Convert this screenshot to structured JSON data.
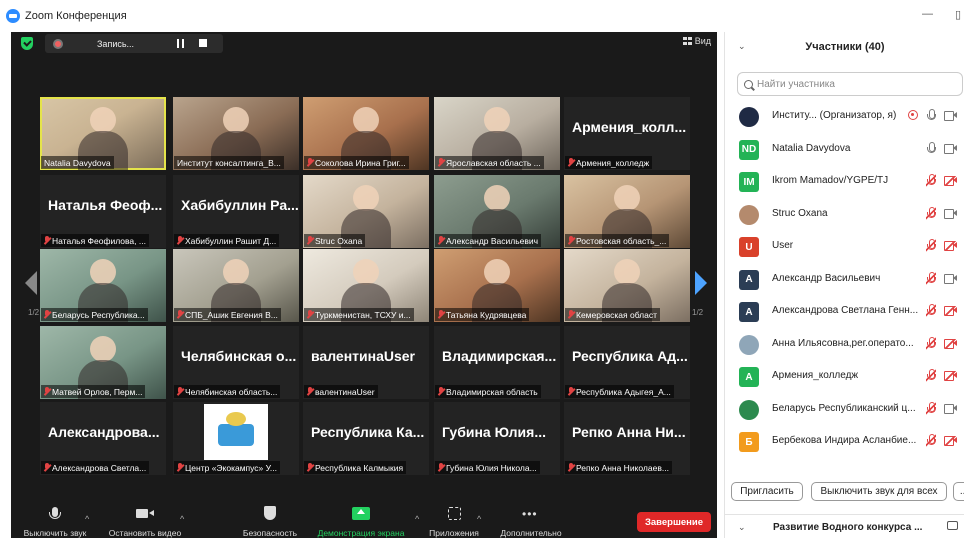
{
  "window": {
    "title": "Zoom Конференция",
    "minimize": "—",
    "maximize": "▯"
  },
  "topbar": {
    "record_label": "Запись...",
    "view_label": "Вид"
  },
  "gallery": {
    "page_left": "1/2",
    "page_right": "1/2",
    "tiles": [
      {
        "caption": "Natalia Davydova",
        "bigname": "",
        "muted": false
      },
      {
        "caption": "Институт консалтинга_В...",
        "bigname": "",
        "muted": false
      },
      {
        "caption": "Соколова Ирина Григ...",
        "bigname": "",
        "muted": true
      },
      {
        "caption": "Ярославская область ...",
        "bigname": "",
        "muted": true
      },
      {
        "caption": "Армения_колледж",
        "bigname": "Армения_колл...",
        "muted": true
      },
      {
        "caption": "Наталья Феофилова, ...",
        "bigname": "Наталья Феоф...",
        "muted": true
      },
      {
        "caption": "Хабибуллин Рашит Д...",
        "bigname": "Хабибуллин Ра...",
        "muted": true
      },
      {
        "caption": "Struc Oxana",
        "bigname": "",
        "muted": true
      },
      {
        "caption": "Александр Васильевич",
        "bigname": "",
        "muted": true
      },
      {
        "caption": "Ростовская область_...",
        "bigname": "",
        "muted": true
      },
      {
        "caption": "Беларусь Республика...",
        "bigname": "",
        "muted": true
      },
      {
        "caption": "СПБ_Ашик Евгения В...",
        "bigname": "",
        "muted": true
      },
      {
        "caption": "Туркменистан, ТСХУ и...",
        "bigname": "",
        "muted": true
      },
      {
        "caption": "Татьяна Кудрявцева",
        "bigname": "",
        "muted": true
      },
      {
        "caption": "Кемеровская област",
        "bigname": "",
        "muted": true
      },
      {
        "caption": "Матвей Орлов, Перм...",
        "bigname": "",
        "muted": true
      },
      {
        "caption": "Челябинская область...",
        "bigname": "Челябинская о...",
        "muted": true
      },
      {
        "caption": "валентинаUser",
        "bigname": "валентинаUser",
        "muted": true
      },
      {
        "caption": "Владимирская область",
        "bigname": "Владимирская...",
        "muted": true
      },
      {
        "caption": "Республика Адыгея_А...",
        "bigname": "Республика Ад...",
        "muted": true
      },
      {
        "caption": "Александрова Светла...",
        "bigname": "Александрова...",
        "muted": true
      },
      {
        "caption": "Центр «Экокампус» У...",
        "bigname": "",
        "muted": true
      },
      {
        "caption": "Республика Калмыкия",
        "bigname": "Республика Ка...",
        "muted": true
      },
      {
        "caption": "Губина Юлия Никола...",
        "bigname": "Губина Юлия...",
        "muted": true
      },
      {
        "caption": "Репко Анна Николаев...",
        "bigname": "Репко Анна Ни...",
        "muted": true
      }
    ]
  },
  "toolbar": {
    "mute": "Выключить звук",
    "stop_video": "Остановить видео",
    "security": "Безопасность",
    "share": "Демонстрация экрана",
    "apps": "Приложения",
    "more": "Дополнительно",
    "end": "Завершение",
    "caret": "^",
    "more_glyph": "•••"
  },
  "participants": {
    "title": "Участники (40)",
    "search_placeholder": "Найти участника",
    "items": [
      {
        "initials": "",
        "name": "Институ... (Организатор, я)",
        "color": "#1f2a44",
        "mic": "on",
        "cam": "off",
        "rec": true
      },
      {
        "initials": "ND",
        "name": "Natalia Davydova",
        "color": "#23b356",
        "mic": "on",
        "cam": "off",
        "rec": false
      },
      {
        "initials": "IM",
        "name": "Ikrom Mamadov/YGPE/TJ",
        "color": "#23b356",
        "mic": "muted",
        "cam": "muted",
        "rec": false
      },
      {
        "initials": "",
        "name": "Struc Oxana",
        "color": "#b48a6d",
        "mic": "muted",
        "cam": "off",
        "rec": false
      },
      {
        "initials": "U",
        "name": "User",
        "color": "#d9412b",
        "mic": "muted",
        "cam": "muted",
        "rec": false
      },
      {
        "initials": "A",
        "name": "Александр Васильевич",
        "color": "#2b3d55",
        "mic": "muted",
        "cam": "off",
        "rec": false
      },
      {
        "initials": "A",
        "name": "Александрова Светлана Генн...",
        "color": "#2b3d55",
        "mic": "muted",
        "cam": "muted",
        "rec": false
      },
      {
        "initials": "",
        "name": "Анна Ильясовна,рег.операто...",
        "color": "#8fa6b8",
        "mic": "muted",
        "cam": "muted",
        "rec": false
      },
      {
        "initials": "A",
        "name": "Армения_колледж",
        "color": "#23b356",
        "mic": "muted",
        "cam": "muted",
        "rec": false
      },
      {
        "initials": "",
        "name": "Беларусь Республиканский ц...",
        "color": "#2c8a4e",
        "mic": "muted",
        "cam": "off",
        "rec": false
      },
      {
        "initials": "Б",
        "name": "Бербекова Индира Асланбие...",
        "color": "#f29b1d",
        "mic": "muted",
        "cam": "muted",
        "rec": false
      }
    ],
    "invite": "Пригласить",
    "mute_all": "Выключить звук для всех",
    "more": "...",
    "chat_title": "Развитие Водного конкурса ..."
  }
}
